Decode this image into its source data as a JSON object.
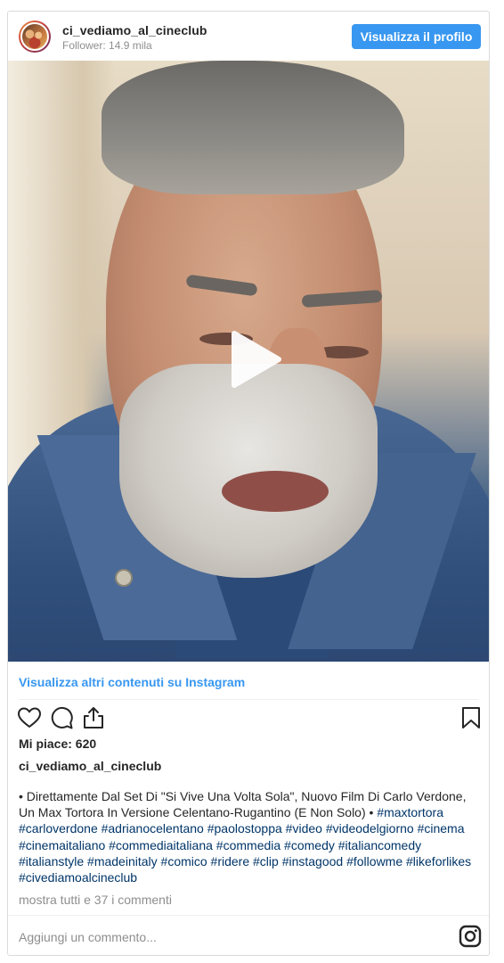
{
  "header": {
    "username": "ci_vediamo_al_cineclub",
    "followers": "Follower: 14.9 mila",
    "profile_button": "Visualizza il profilo"
  },
  "media": {
    "type": "video",
    "play_icon": "play-icon"
  },
  "more_link": "Visualizza altri contenuti su Instagram",
  "actions": {
    "icons": [
      "heart-icon",
      "comment-icon",
      "share-icon",
      "bookmark-icon"
    ]
  },
  "likes": "Mi piace: 620",
  "caption": {
    "username": "ci_vediamo_al_cineclub",
    "text": "• Direttamente Dal Set Di \"Si Vive Una Volta Sola\", Nuovo Film Di Carlo Verdone, Un Max Tortora In Versione Celentano-Rugantino (E Non Solo) •",
    "hashtags": "#maxtortora #carloverdone #adrianocelentano #paolostoppa #video #videodelgiorno #cinema #cinemaitaliano #commediaitaliana #commedia #comedy #italiancomedy #italianstyle #madeinitaly #comico #ridere #clip #instagood #followme #likeforlikes #civediamoalcineclub"
  },
  "comments_link": "mostra tutti e 37 i commenti",
  "add_comment_placeholder": "Aggiungi un commento...",
  "colors": {
    "accent": "#3897f0",
    "hashtag": "#003569",
    "muted": "#8e8e8e",
    "text": "#262626"
  }
}
